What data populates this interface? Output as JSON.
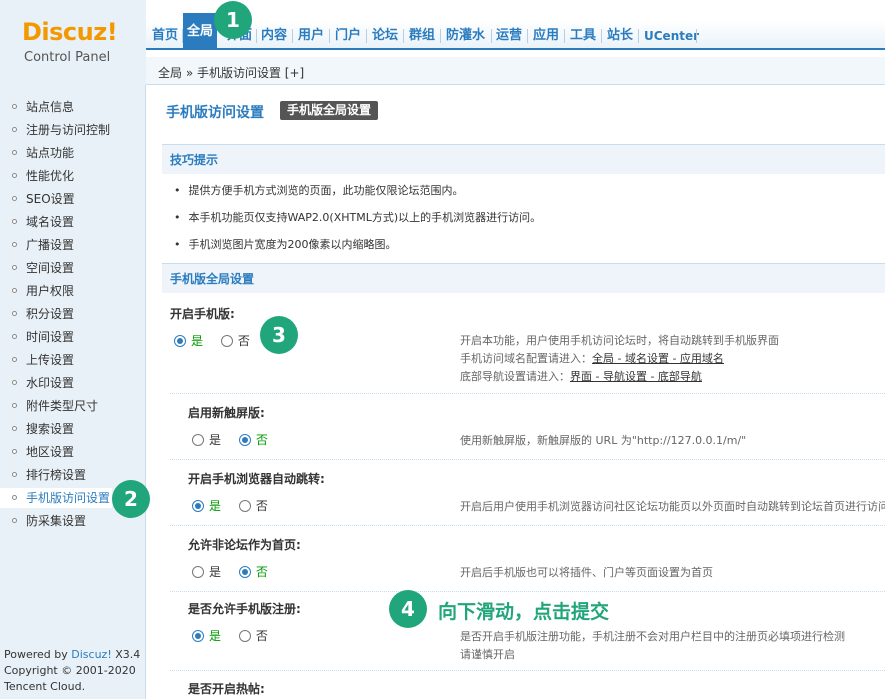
{
  "logo": {
    "main": "Discuz!",
    "sub": "Control Panel"
  },
  "topnav": [
    "首页",
    "全局",
    "界面",
    "内容",
    "用户",
    "门户",
    "论坛",
    "群组",
    "防灌水",
    "运营",
    "应用",
    "工具",
    "站长",
    "UCenter"
  ],
  "breadcrumb": "全局 » 手机版访问设置  [+]",
  "sidebar": {
    "items": [
      "站点信息",
      "注册与访问控制",
      "站点功能",
      "性能优化",
      "SEO设置",
      "域名设置",
      "广播设置",
      "空间设置",
      "用户权限",
      "积分设置",
      "时间设置",
      "上传设置",
      "水印设置",
      "附件类型尺寸",
      "搜索设置",
      "地区设置",
      "排行榜设置",
      "手机版访问设置",
      "防采集设置"
    ],
    "active_index": 17,
    "powered_prefix": "Powered by",
    "powered_brand": "Discuz!",
    "powered_version": "X3.4",
    "copyright": "Copyright © 2001-2020",
    "company": "Tencent Cloud."
  },
  "main": {
    "title": "手机版访问设置",
    "tab": "手机版全局设置",
    "tips_head": "技巧提示",
    "tips": [
      "提供方便手机方式浏览的页面，此功能仅限论坛范围内。",
      "本手机功能页仅支持WAP2.0(XHTML方式)以上的手机浏览器进行访问。",
      "手机浏览图片宽度为200像素以内缩略图。"
    ],
    "settings_head": "手机版全局设置",
    "rows": [
      {
        "label": "开启手机版:",
        "yes": "是",
        "no": "否",
        "selected": "yes",
        "desc1": "开启本功能，用户使用手机访问论坛时，将自动跳转到手机版界面",
        "desc2_prefix": "手机访问域名配置请进入：",
        "desc2_link": "全局 - 域名设置 - 应用域名",
        "desc3_prefix": "底部导航设置请进入：",
        "desc3_link": "界面 - 导航设置 - 底部导航"
      },
      {
        "label": "启用新触屏版:",
        "yes": "是",
        "no": "否",
        "selected": "no",
        "desc1": "使用新触屏版，新触屏版的 URL 为\"http://127.0.0.1/m/\""
      },
      {
        "label": "开启手机浏览器自动跳转:",
        "yes": "是",
        "no": "否",
        "selected": "yes",
        "desc1": "开启后用户使用手机浏览器访问社区论坛功能页以外页面时自动跳转到论坛首页进行访问"
      },
      {
        "label": "允许非论坛作为首页:",
        "yes": "是",
        "no": "否",
        "selected": "no",
        "desc1": "开启后手机版也可以将插件、门户等页面设置为首页"
      },
      {
        "label": "是否允许手机版注册:",
        "yes": "是",
        "no": "否",
        "selected": "yes",
        "desc1": "是否开启手机版注册功能，手机注册不会对用户栏目中的注册页必填项进行检测",
        "desc2_prefix": "请谨慎开启"
      },
      {
        "label": "是否开启热帖:"
      }
    ]
  },
  "steps": {
    "s1": "1",
    "s2": "2",
    "s3": "3",
    "s4": "4",
    "s4_text": "向下滑动，点击提交"
  },
  "colors": {
    "accent": "#2b7cbf",
    "badge": "#20a67a",
    "logo": "#f39800"
  }
}
